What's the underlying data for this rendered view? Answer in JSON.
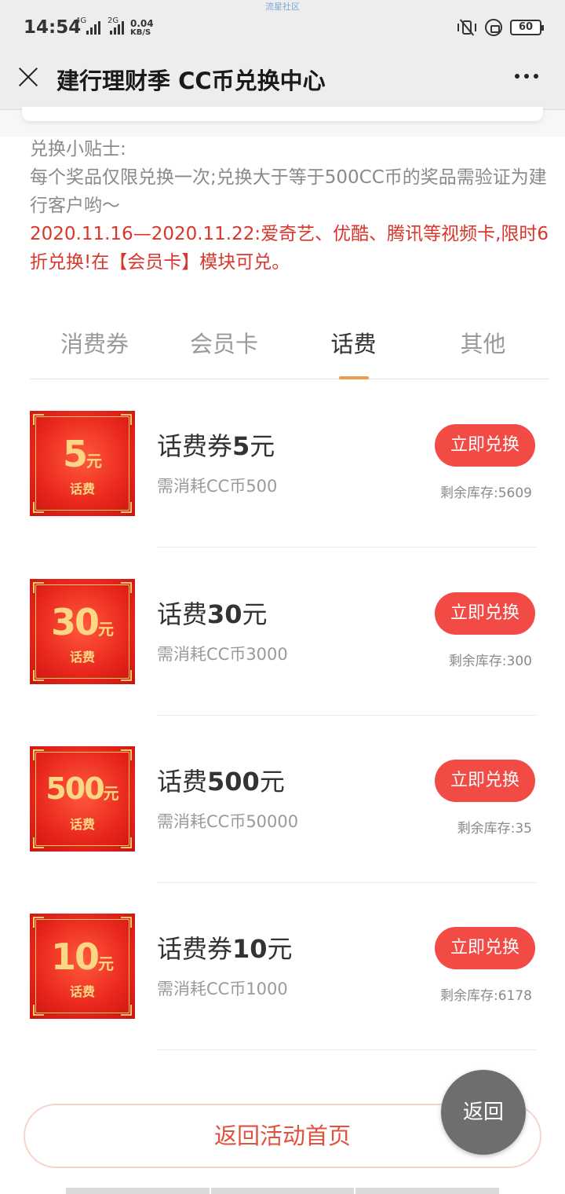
{
  "status_bar": {
    "time": "14:54",
    "net1": "4G",
    "net2": "2G",
    "speed_value": "0.04",
    "speed_unit": "KB/S",
    "watermark": "流星社区",
    "battery": "60"
  },
  "header": {
    "title": "建行理财季 CC币兑换中心"
  },
  "tips": {
    "heading": "兑换小贴士:",
    "line1": "每个奖品仅限兑换一次;兑换大于等于500CC币的奖品需验证为建行客户哟～",
    "promo": "2020.11.16—2020.11.22:爱奇艺、优酷、腾讯等视频卡,限时6折兑换!在【会员卡】模块可兑。"
  },
  "tabs": [
    {
      "label": "消费券"
    },
    {
      "label": "会员卡"
    },
    {
      "label": "话费",
      "active": true
    },
    {
      "label": "其他"
    }
  ],
  "items": [
    {
      "thumb_amount": "5",
      "thumb_unit": "元",
      "thumb_sub": "话费",
      "name_prefix": "话费券",
      "name_amount": "5",
      "name_unit": "元",
      "cost": "需消耗CC币500",
      "button": "立即兑换",
      "stock": "剩余库存:5609"
    },
    {
      "thumb_amount": "30",
      "thumb_unit": "元",
      "thumb_sub": "话费",
      "name_prefix": "话费",
      "name_amount": "30",
      "name_unit": "元",
      "cost": "需消耗CC币3000",
      "button": "立即兑换",
      "stock": "剩余库存:300"
    },
    {
      "thumb_amount": "500",
      "thumb_unit": "元",
      "thumb_sub": "话费",
      "name_prefix": "话费",
      "name_amount": "500",
      "name_unit": "元",
      "cost": "需消耗CC币50000",
      "button": "立即兑换",
      "stock": "剩余库存:35"
    },
    {
      "thumb_amount": "10",
      "thumb_unit": "元",
      "thumb_sub": "话费",
      "name_prefix": "话费券",
      "name_amount": "10",
      "name_unit": "元",
      "cost": "需消耗CC币1000",
      "button": "立即兑换",
      "stock": "剩余库存:6178"
    }
  ],
  "bottom": {
    "home_button": "返回活动首页",
    "back_button": "返回"
  },
  "colors": {
    "accent_red": "#f24a45",
    "promo_red": "#d9352b",
    "tab_underline": "#f19a4f"
  }
}
